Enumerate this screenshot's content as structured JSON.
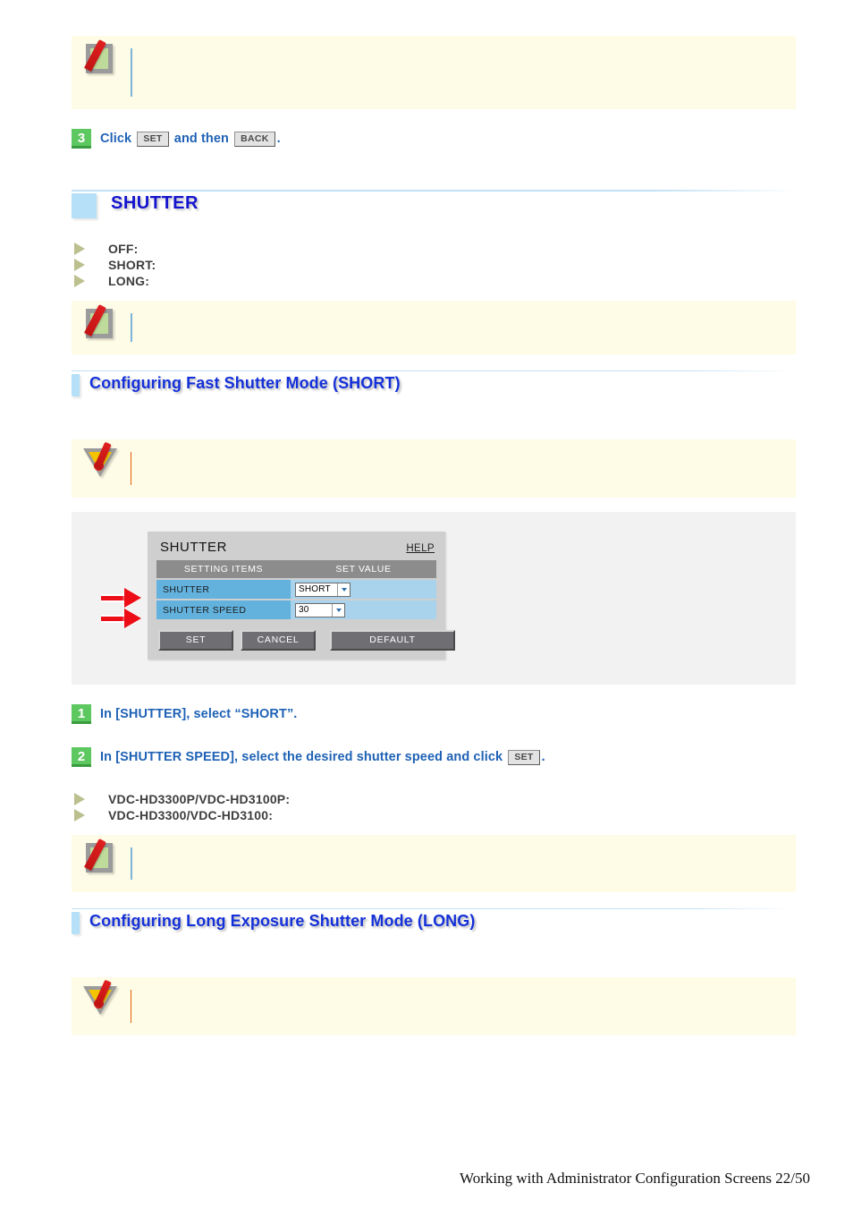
{
  "document": {
    "footer": "Working with Administrator Configuration Screens 22/50"
  },
  "notes": [
    {
      "id": "note-top",
      "icon": "memo-icon",
      "text": ""
    },
    {
      "id": "note-after-modes",
      "icon": "memo-icon",
      "text": ""
    },
    {
      "id": "note-warning-short",
      "icon": "warning-icon",
      "text": ""
    },
    {
      "id": "note-after-models",
      "icon": "memo-icon",
      "text": ""
    },
    {
      "id": "note-warning-long",
      "icon": "warning-icon",
      "text": ""
    }
  ],
  "steps": {
    "step3": {
      "number": "3",
      "prefix": "Click",
      "button1": "SET",
      "middle": "and then",
      "button2": "BACK",
      "suffix": "."
    },
    "step1": {
      "number": "1",
      "text": "In [SHUTTER], select “SHORT”."
    },
    "step2": {
      "number": "2",
      "prefix": "In [SHUTTER SPEED], select the desired shutter speed and click",
      "button1": "SET",
      "suffix": "."
    }
  },
  "heading_main": {
    "title": "SHUTTER"
  },
  "shutter_modes": [
    {
      "label": "OFF:"
    },
    {
      "label": "SHORT:"
    },
    {
      "label": "LONG:"
    }
  ],
  "section_short": {
    "title": "Configuring Fast Shutter Mode (SHORT)"
  },
  "section_long": {
    "title": "Configuring Long Exposure Shutter Mode (LONG)"
  },
  "models": [
    {
      "label": "VDC-HD3300P/VDC-HD3100P:"
    },
    {
      "label": "VDC-HD3300/VDC-HD3100:"
    }
  ],
  "dialog": {
    "title": "SHUTTER",
    "help_label": "HELP",
    "columns": {
      "items": "SETTING ITEMS",
      "value": "SET VALUE"
    },
    "rows": [
      {
        "label": "SHUTTER",
        "value": "SHORT"
      },
      {
        "label": "SHUTTER SPEED",
        "value": "30"
      }
    ],
    "buttons": {
      "set": "SET",
      "cancel": "CANCEL",
      "default": "DEFAULT"
    }
  },
  "colors": {
    "heading_blue": "#1414cf",
    "step_text_blue": "#1f62b5",
    "badge_green": "#5dc760",
    "note_bg": "#fefce6",
    "accent_light_blue": "#b5e0f7",
    "dialog_row_label": "#63b2de",
    "dialog_row_value": "#a9d2ec",
    "arrow_red": "#ec0d16",
    "panel_gray": "#f2f2f2"
  }
}
